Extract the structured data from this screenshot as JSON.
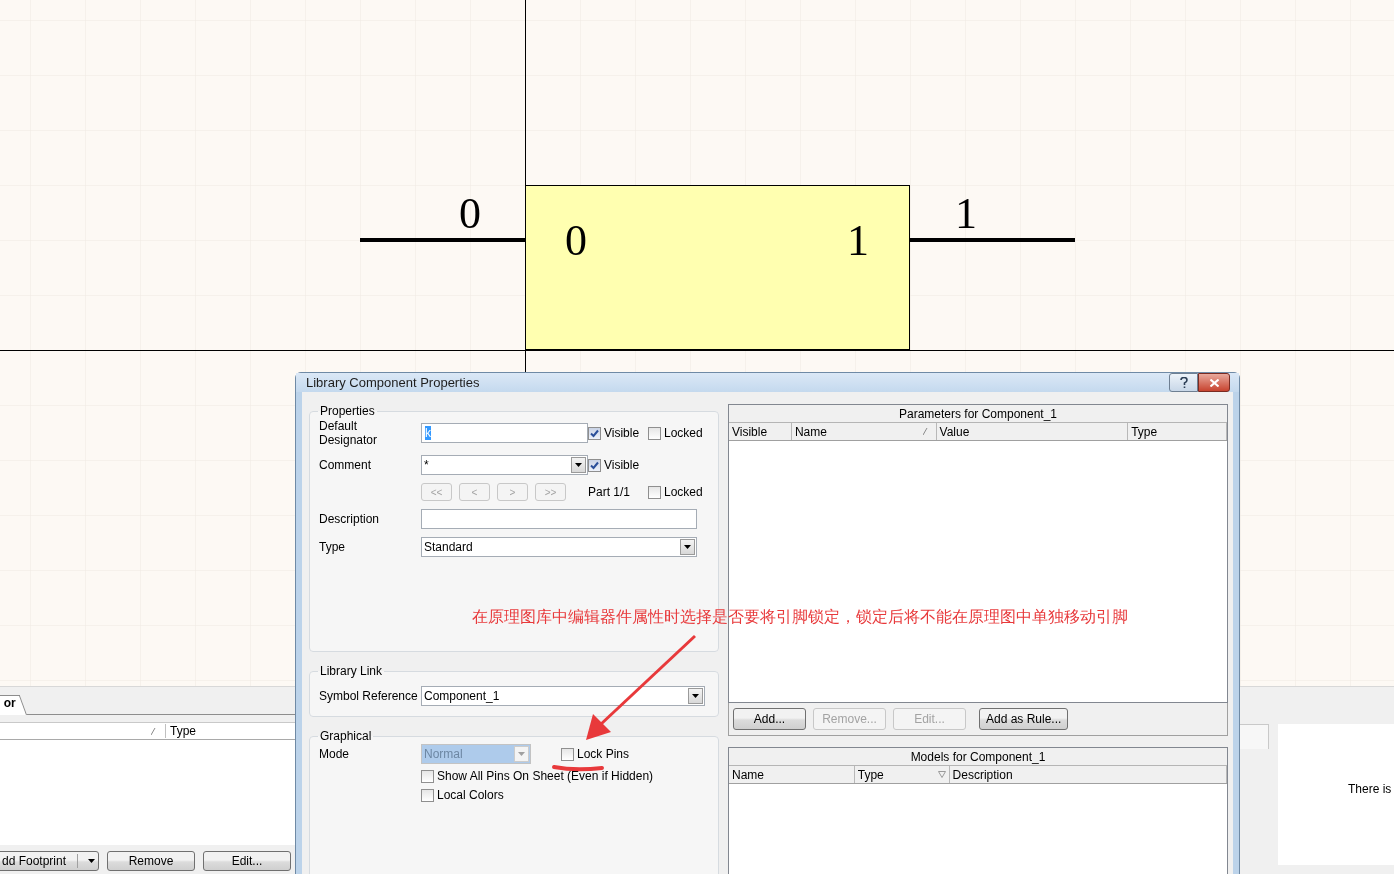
{
  "schematic": {
    "pins": [
      {
        "number": "0",
        "name": "0"
      },
      {
        "number": "1",
        "name": "1"
      }
    ]
  },
  "back_panel": {
    "tab": "or",
    "columns": [
      {
        "sorted": true
      },
      {
        "label": "Type",
        "sorted": false
      }
    ],
    "buttons": [
      {
        "label": "dd Footprint",
        "kind": "dropdown"
      },
      {
        "label": "Remove",
        "kind": "plain"
      },
      {
        "label": "Edit...",
        "kind": "plain"
      }
    ]
  },
  "side_panel": {
    "message": "There is"
  },
  "dialog": {
    "title": "Library Component Properties",
    "properties": {
      "title": "Properties",
      "designator": {
        "label": "Default Designator",
        "value": "k",
        "text_selected": true,
        "checks": [
          {
            "label": "Visible",
            "checked": true
          },
          {
            "label": "Locked",
            "checked": false
          }
        ]
      },
      "comment": {
        "label": "Comment",
        "value": "*",
        "checks": [
          {
            "label": "Visible",
            "checked": true
          }
        ]
      },
      "part_nav": {
        "buttons": [
          {
            "label": "<<",
            "disabled": true
          },
          {
            "label": "<",
            "disabled": true
          },
          {
            "label": ">",
            "disabled": true
          },
          {
            "label": ">>",
            "disabled": true
          }
        ],
        "part": "Part 1/1",
        "checks": [
          {
            "label": "Locked",
            "checked": false
          }
        ]
      },
      "description": {
        "label": "Description"
      },
      "type": {
        "label": "Type",
        "value": "Standard"
      }
    },
    "library_link": {
      "title": "Library Link",
      "symbol_reference": {
        "label": "Symbol Reference",
        "value": "Component_1"
      }
    },
    "graphical": {
      "title": "Graphical",
      "mode": {
        "label": "Mode",
        "value": "Normal",
        "disabled": true
      },
      "checks": [
        {
          "label": "Lock Pins",
          "checked": false
        },
        {
          "label": "Show All Pins On Sheet (Even if Hidden)",
          "checked": false
        },
        {
          "label": "Local Colors",
          "checked": false
        }
      ]
    },
    "parameters": {
      "title": "Parameters for Component_1",
      "columns": [
        {
          "label": "Visible",
          "sorted": false
        },
        {
          "label": "Name",
          "sorted": true
        },
        {
          "label": "Value",
          "sorted": false
        },
        {
          "label": "Type",
          "sorted": false
        }
      ],
      "buttons": [
        {
          "label": "Add...",
          "disabled": false
        },
        {
          "label": "Remove...",
          "disabled": true
        },
        {
          "label": "Edit...",
          "disabled": true
        },
        {
          "label": "Add as Rule...",
          "disabled": false
        }
      ]
    },
    "models": {
      "title": "Models for Component_1",
      "columns": [
        {
          "label": "Name",
          "filtered": false
        },
        {
          "label": "Type",
          "filtered": true
        },
        {
          "label": "Description",
          "filtered": false
        }
      ]
    }
  },
  "annotation": {
    "text": "在原理图库中编辑器件属性时选择是否要将引脚锁定，锁定后将不能在原理图中单独移动引脚"
  }
}
